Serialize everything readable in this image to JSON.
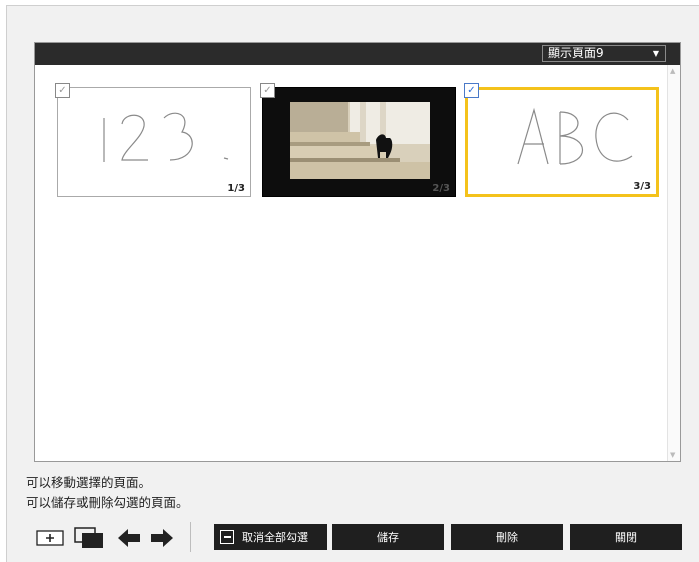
{
  "header": {
    "page_select_value": "顯示頁面9"
  },
  "thumbnails": [
    {
      "page": "1/3",
      "content": "123",
      "checked": false
    },
    {
      "page": "2/3",
      "content": "photo",
      "checked": false
    },
    {
      "page": "3/3",
      "content": "ABC",
      "checked": true,
      "selected": true
    }
  ],
  "status": {
    "line1": "可以移動選擇的頁面。",
    "line2": "可以儲存或刪除勾選的頁面。"
  },
  "toolbar": {
    "deselect_all_label": "取消全部勾選",
    "save_label": "儲存",
    "delete_label": "刪除",
    "close_label": "關閉"
  },
  "colors": {
    "selected_border": "#f4c21b",
    "check_accent": "#2f6fd6",
    "header_bg": "#2b2b2b",
    "button_bg": "#1f1f1f"
  },
  "icons": [
    "add-page-icon",
    "window-icon",
    "arrow-left-icon",
    "arrow-right-icon",
    "minus-box-icon",
    "checkmark-icon",
    "dropdown-arrow-icon"
  ]
}
